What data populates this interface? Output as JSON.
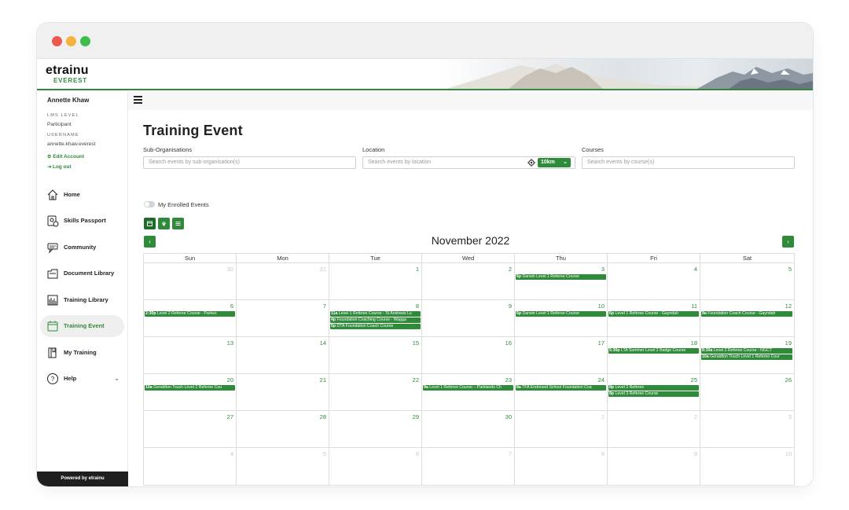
{
  "brand": {
    "name": "etrainu",
    "sub": "EVEREST"
  },
  "user": {
    "name": "Annette Khaw",
    "lms_label": "LMS LEVEL",
    "lms_value": "Participant",
    "username_label": "USERNAME",
    "username_value": "annette.khaw.everest",
    "edit_account": "Edit Account",
    "logout": "Log out"
  },
  "nav": [
    {
      "label": "Home",
      "icon": "home-icon"
    },
    {
      "label": "Skills Passport",
      "icon": "passport-icon"
    },
    {
      "label": "Community",
      "icon": "community-icon"
    },
    {
      "label": "Document Library",
      "icon": "document-icon"
    },
    {
      "label": "Training Library",
      "icon": "library-icon"
    },
    {
      "label": "Training Event",
      "icon": "calendar-icon",
      "active": true
    },
    {
      "label": "My Training",
      "icon": "book-icon"
    },
    {
      "label": "Help",
      "icon": "help-icon"
    }
  ],
  "powered_by": "Powered by etrainu",
  "page": {
    "title": "Training Event",
    "filters": {
      "sub_org_label": "Sub-Organisations",
      "sub_org_placeholder": "Search events by sub-organisation(s)",
      "location_label": "Location",
      "location_placeholder": "Search events by location",
      "radius": "10km",
      "courses_label": "Courses",
      "courses_placeholder": "Search events by course(s)"
    },
    "enrolled_toggle_label": "My Enrolled Events",
    "month_title": "November 2022",
    "prev": "‹",
    "next": "›"
  },
  "calendar": {
    "weekdays": [
      "Sun",
      "Mon",
      "Tue",
      "Wed",
      "Thu",
      "Fri",
      "Sat"
    ],
    "weeks": [
      [
        {
          "d": "30",
          "m": true
        },
        {
          "d": "31",
          "m": true
        },
        {
          "d": "1"
        },
        {
          "d": "2"
        },
        {
          "d": "3",
          "events": [
            {
              "t": "6p",
              "n": "Darwin Level 1 Referee Course"
            }
          ]
        },
        {
          "d": "4"
        },
        {
          "d": "5"
        }
      ],
      [
        {
          "d": "6",
          "events": [
            {
              "t": "2:30p",
              "n": "Level 2 Referee Course - Parkes"
            }
          ]
        },
        {
          "d": "7"
        },
        {
          "d": "8",
          "events": [
            {
              "t": "11a",
              "n": "Level 1 Referee Course - St Andrews Lu"
            },
            {
              "t": "4p",
              "n": "Foundation Coaching Course - Wagga"
            },
            {
              "t": "5p",
              "n": "DTA Foundation Coach Course"
            }
          ]
        },
        {
          "d": "9"
        },
        {
          "d": "10",
          "events": [
            {
              "t": "6p",
              "n": "Darwin Level 1 Referee Course"
            }
          ]
        },
        {
          "d": "11",
          "events": [
            {
              "t": "6p",
              "n": "Level 1 Referee Course - Gayndah"
            }
          ]
        },
        {
          "d": "12",
          "events": [
            {
              "t": "9a",
              "n": "Foundation Coach Course - Gayndah"
            }
          ]
        }
      ],
      [
        {
          "d": "13"
        },
        {
          "d": "14"
        },
        {
          "d": "15"
        },
        {
          "d": "16"
        },
        {
          "d": "17"
        },
        {
          "d": "18",
          "events": [
            {
              "t": "5:30p",
              "n": "LTA Summer Level 2 Badge Course"
            }
          ]
        },
        {
          "d": "19",
          "events": [
            {
              "t": "8:30a",
              "n": "Level 2 Referee Course - NGCT"
            },
            {
              "t": "10a",
              "n": "Geraldton Touch Level 1 Referee Cour"
            }
          ]
        }
      ],
      [
        {
          "d": "20",
          "events": [
            {
              "t": "10a",
              "n": "Geraldton Touch Level 2 Referee Cou"
            }
          ]
        },
        {
          "d": "21"
        },
        {
          "d": "22"
        },
        {
          "d": "23",
          "events": [
            {
              "t": "9a",
              "n": "Level 1 Referee Course – Parklands Ch"
            }
          ]
        },
        {
          "d": "24",
          "events": [
            {
              "t": "8a",
              "n": "TFA Endorsed School Foundation Coa"
            }
          ]
        },
        {
          "d": "25",
          "events": [
            {
              "t": "8p",
              "n": "Level 2 Referee"
            },
            {
              "t": "8p",
              "n": "Level 3 Referee Course"
            }
          ]
        },
        {
          "d": "26"
        }
      ],
      [
        {
          "d": "27"
        },
        {
          "d": "28"
        },
        {
          "d": "29"
        },
        {
          "d": "30"
        },
        {
          "d": "1",
          "m": true
        },
        {
          "d": "2",
          "m": true
        },
        {
          "d": "3",
          "m": true
        }
      ],
      [
        {
          "d": "4",
          "m": true
        },
        {
          "d": "5",
          "m": true
        },
        {
          "d": "6",
          "m": true
        },
        {
          "d": "7",
          "m": true
        },
        {
          "d": "8",
          "m": true
        },
        {
          "d": "9",
          "m": true
        },
        {
          "d": "10",
          "m": true
        }
      ]
    ]
  },
  "colors": {
    "accent": "#2f8a3a",
    "accent_dark": "#1f6c2a",
    "muted_day": "#c8c8c8"
  }
}
